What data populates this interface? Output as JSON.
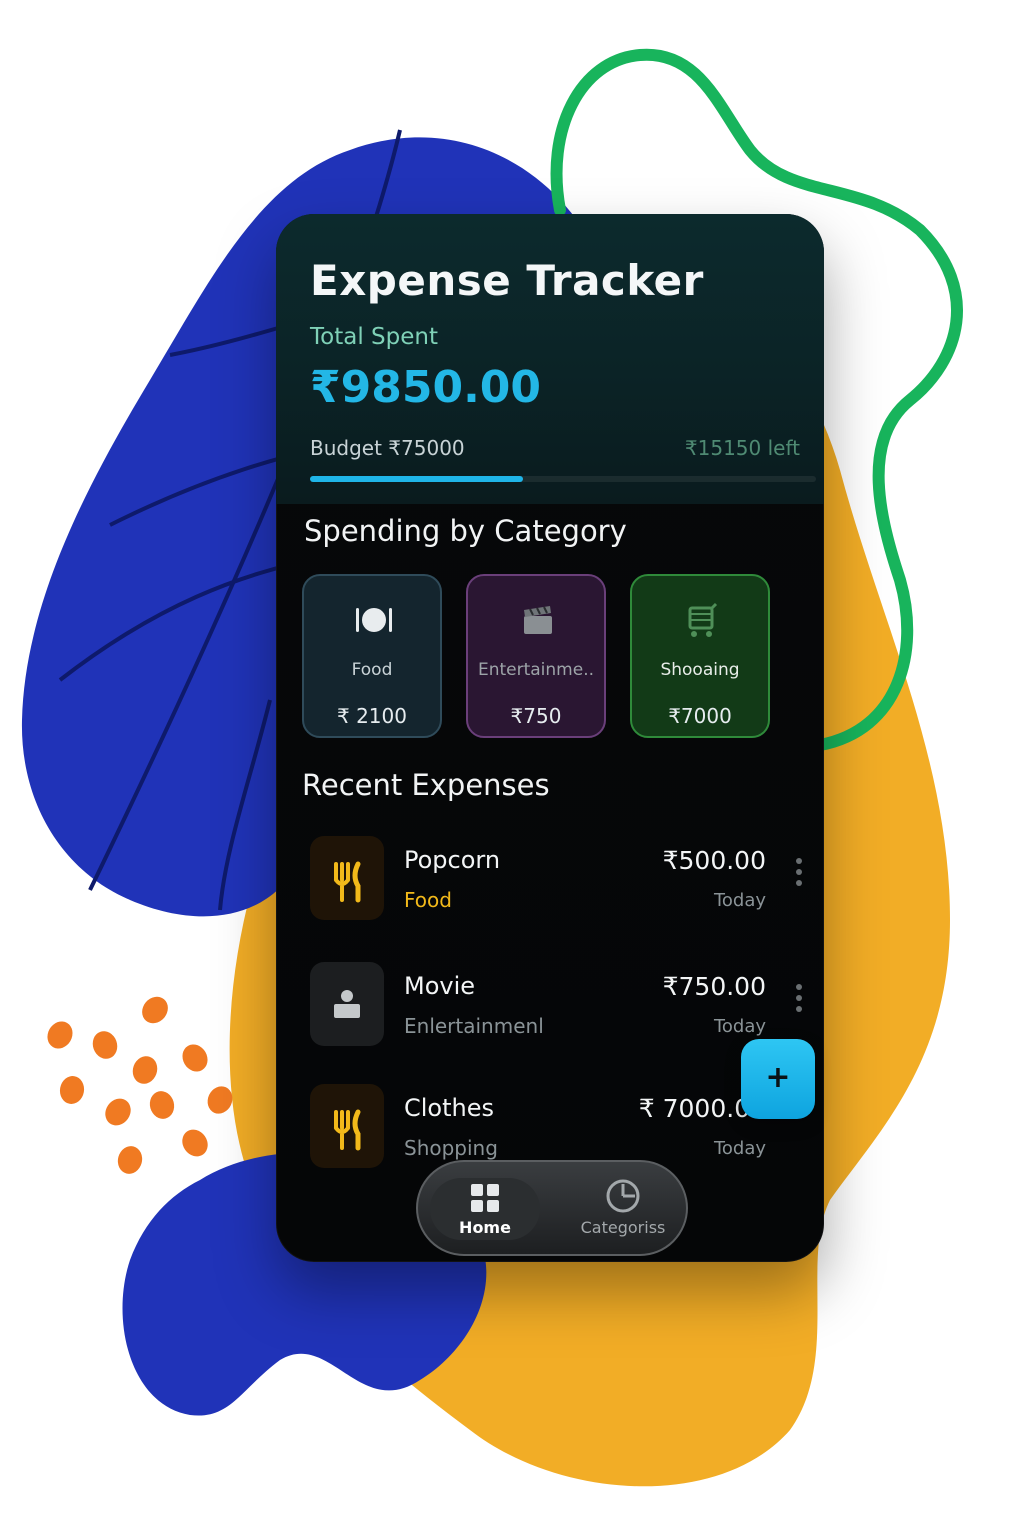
{
  "app": {
    "title": "Expense Tracker",
    "total_label": "Total Spent",
    "total_value": "₹9850.00",
    "budget_label": "Budget  ₹75000",
    "left_label": "₹15150 left",
    "budget_used_fraction": 0.42
  },
  "categories": {
    "title": "Spending by Category",
    "items": [
      {
        "name": "Food",
        "amount": "₹ 2100",
        "icon": "plate-icon",
        "color": "#2f4b5a"
      },
      {
        "name": "Entertainme..",
        "amount": "₹750",
        "icon": "clapperboard-icon",
        "color": "#6a3f7a"
      },
      {
        "name": "Shooaing",
        "amount": "₹7000",
        "icon": "cart-icon",
        "color": "#2f8a3a"
      }
    ]
  },
  "recent": {
    "title": "Recent Expenses",
    "items": [
      {
        "name": "Popcorn",
        "category": "Food",
        "amount": "₹500.00",
        "date": "Today",
        "icon": "fork-knife-icon"
      },
      {
        "name": "Movie",
        "category": "Enlertainmenl",
        "amount": "₹750.00",
        "date": "Today",
        "icon": "ticket-icon"
      },
      {
        "name": "Clothes",
        "category": "Shopping",
        "amount": "₹ 7000.00",
        "date": "Today",
        "icon": "fork-knife-icon"
      }
    ]
  },
  "nav": {
    "home_label": "Home",
    "categories_label": "Categoriss"
  },
  "fab": {
    "label": "+"
  },
  "colors": {
    "accent": "#1fb5e8",
    "food_text": "#f2b91a",
    "secondary_text": "#8a9397",
    "blob_blue": "#2033b8",
    "blob_yellow": "#f2ad26",
    "squiggle_green": "#18b45c",
    "dots_orange": "#f07a22"
  }
}
